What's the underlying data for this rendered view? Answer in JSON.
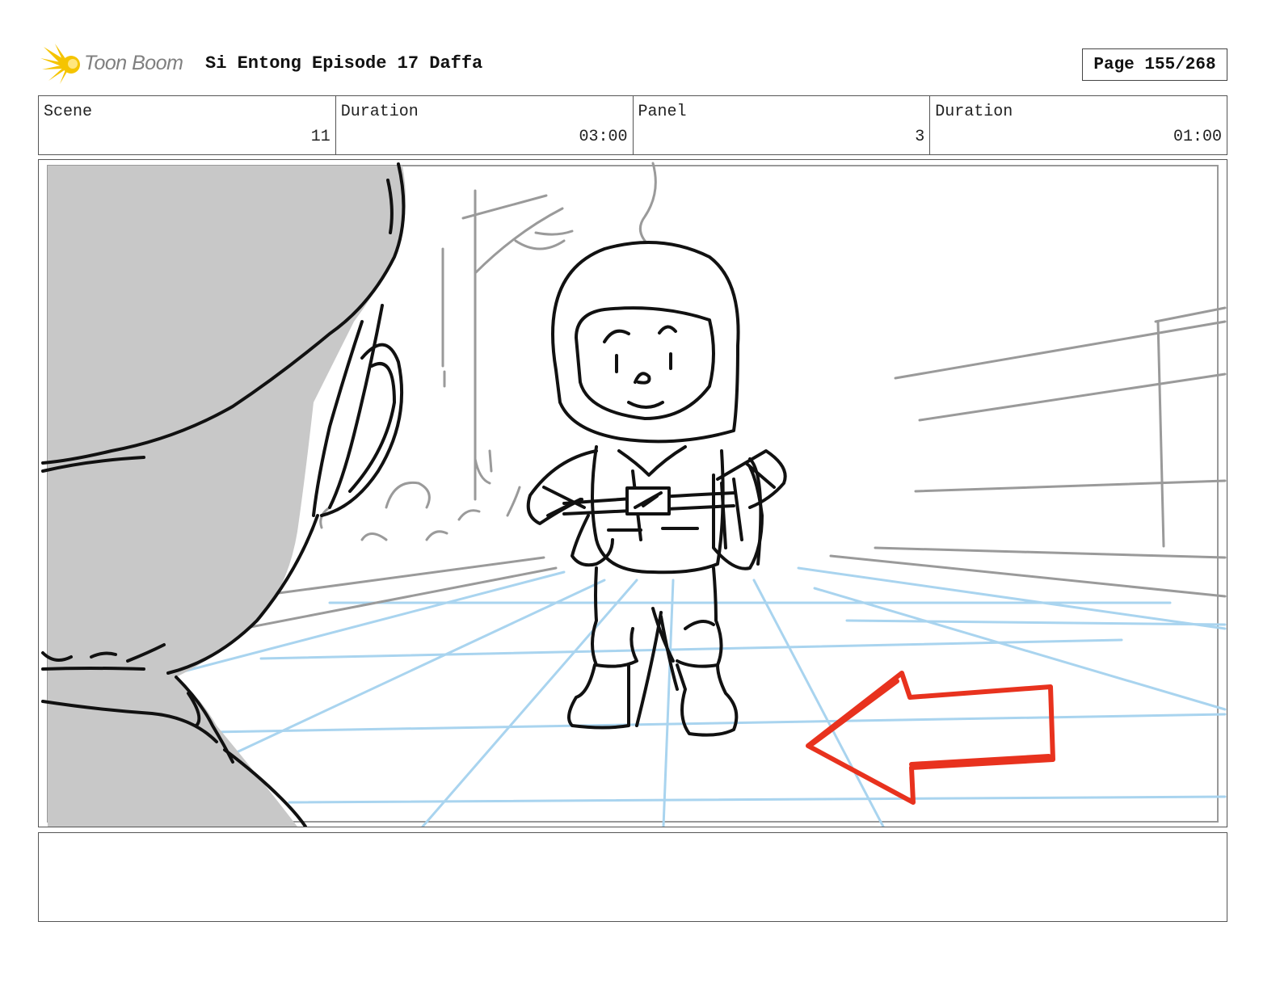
{
  "header": {
    "logo_text": "Toon Boom",
    "logo_icon": "starburst-logo-icon",
    "title": "Si Entong Episode 17 Daffa",
    "page_label": "Page 155/268"
  },
  "info": [
    {
      "label": "Scene",
      "value": "11"
    },
    {
      "label": "Duration",
      "value": "03:00"
    },
    {
      "label": "Panel",
      "value": "3"
    },
    {
      "label": "Duration",
      "value": "01:00"
    }
  ],
  "colors": {
    "sketch_line": "#111111",
    "background_line": "#9a9a9a",
    "grid_line": "#a9d4ef",
    "arrow": "#e8321e",
    "foreground_fill": "#c8c8c8",
    "logo": "#f5c400"
  },
  "notes": ""
}
